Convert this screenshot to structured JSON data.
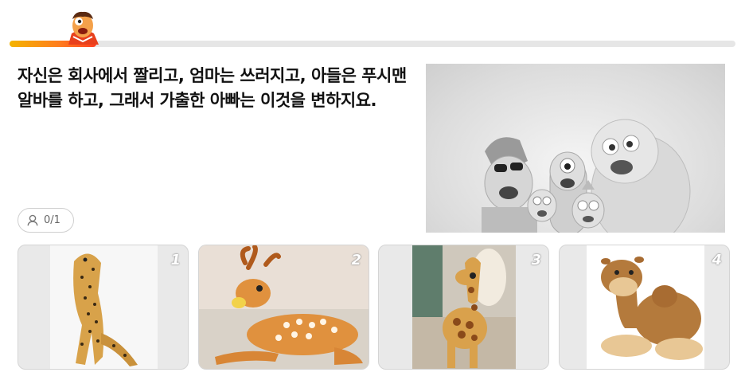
{
  "progress": {
    "fraction": 0.12
  },
  "question": {
    "text": "자신은 회사에서 짤리고, 엄마는 쓰러지고, 아들은 푸시맨 알바를 하고, 그래서 가출한 아빠는 이것을 변하지요."
  },
  "hero_image": {
    "icon": "cartoon-characters-image",
    "palette": "grayscale"
  },
  "counter": {
    "icon": "user-icon",
    "text": "0/1"
  },
  "choices": [
    {
      "number": "1",
      "icon": "cheetah-plush-image"
    },
    {
      "number": "2",
      "icon": "deer-plush-image"
    },
    {
      "number": "3",
      "icon": "giraffe-plush-image"
    },
    {
      "number": "4",
      "icon": "camel-plush-image"
    }
  ],
  "colors": {
    "accent_start": "#f4b400",
    "accent_end": "#ff3d1f",
    "text": "#111111",
    "border": "#d4d4d4"
  }
}
